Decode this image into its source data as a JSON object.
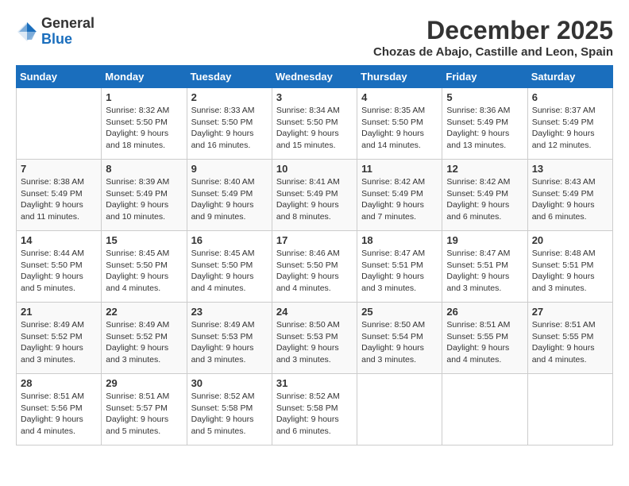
{
  "header": {
    "logo_general": "General",
    "logo_blue": "Blue",
    "month_year": "December 2025",
    "location": "Chozas de Abajo, Castille and Leon, Spain"
  },
  "weekdays": [
    "Sunday",
    "Monday",
    "Tuesday",
    "Wednesday",
    "Thursday",
    "Friday",
    "Saturday"
  ],
  "weeks": [
    [
      {
        "day": "",
        "sunrise": "",
        "sunset": "",
        "daylight": ""
      },
      {
        "day": "1",
        "sunrise": "Sunrise: 8:32 AM",
        "sunset": "Sunset: 5:50 PM",
        "daylight": "Daylight: 9 hours and 18 minutes."
      },
      {
        "day": "2",
        "sunrise": "Sunrise: 8:33 AM",
        "sunset": "Sunset: 5:50 PM",
        "daylight": "Daylight: 9 hours and 16 minutes."
      },
      {
        "day": "3",
        "sunrise": "Sunrise: 8:34 AM",
        "sunset": "Sunset: 5:50 PM",
        "daylight": "Daylight: 9 hours and 15 minutes."
      },
      {
        "day": "4",
        "sunrise": "Sunrise: 8:35 AM",
        "sunset": "Sunset: 5:50 PM",
        "daylight": "Daylight: 9 hours and 14 minutes."
      },
      {
        "day": "5",
        "sunrise": "Sunrise: 8:36 AM",
        "sunset": "Sunset: 5:49 PM",
        "daylight": "Daylight: 9 hours and 13 minutes."
      },
      {
        "day": "6",
        "sunrise": "Sunrise: 8:37 AM",
        "sunset": "Sunset: 5:49 PM",
        "daylight": "Daylight: 9 hours and 12 minutes."
      }
    ],
    [
      {
        "day": "7",
        "sunrise": "Sunrise: 8:38 AM",
        "sunset": "Sunset: 5:49 PM",
        "daylight": "Daylight: 9 hours and 11 minutes."
      },
      {
        "day": "8",
        "sunrise": "Sunrise: 8:39 AM",
        "sunset": "Sunset: 5:49 PM",
        "daylight": "Daylight: 9 hours and 10 minutes."
      },
      {
        "day": "9",
        "sunrise": "Sunrise: 8:40 AM",
        "sunset": "Sunset: 5:49 PM",
        "daylight": "Daylight: 9 hours and 9 minutes."
      },
      {
        "day": "10",
        "sunrise": "Sunrise: 8:41 AM",
        "sunset": "Sunset: 5:49 PM",
        "daylight": "Daylight: 9 hours and 8 minutes."
      },
      {
        "day": "11",
        "sunrise": "Sunrise: 8:42 AM",
        "sunset": "Sunset: 5:49 PM",
        "daylight": "Daylight: 9 hours and 7 minutes."
      },
      {
        "day": "12",
        "sunrise": "Sunrise: 8:42 AM",
        "sunset": "Sunset: 5:49 PM",
        "daylight": "Daylight: 9 hours and 6 minutes."
      },
      {
        "day": "13",
        "sunrise": "Sunrise: 8:43 AM",
        "sunset": "Sunset: 5:49 PM",
        "daylight": "Daylight: 9 hours and 6 minutes."
      }
    ],
    [
      {
        "day": "14",
        "sunrise": "Sunrise: 8:44 AM",
        "sunset": "Sunset: 5:50 PM",
        "daylight": "Daylight: 9 hours and 5 minutes."
      },
      {
        "day": "15",
        "sunrise": "Sunrise: 8:45 AM",
        "sunset": "Sunset: 5:50 PM",
        "daylight": "Daylight: 9 hours and 4 minutes."
      },
      {
        "day": "16",
        "sunrise": "Sunrise: 8:45 AM",
        "sunset": "Sunset: 5:50 PM",
        "daylight": "Daylight: 9 hours and 4 minutes."
      },
      {
        "day": "17",
        "sunrise": "Sunrise: 8:46 AM",
        "sunset": "Sunset: 5:50 PM",
        "daylight": "Daylight: 9 hours and 4 minutes."
      },
      {
        "day": "18",
        "sunrise": "Sunrise: 8:47 AM",
        "sunset": "Sunset: 5:51 PM",
        "daylight": "Daylight: 9 hours and 3 minutes."
      },
      {
        "day": "19",
        "sunrise": "Sunrise: 8:47 AM",
        "sunset": "Sunset: 5:51 PM",
        "daylight": "Daylight: 9 hours and 3 minutes."
      },
      {
        "day": "20",
        "sunrise": "Sunrise: 8:48 AM",
        "sunset": "Sunset: 5:51 PM",
        "daylight": "Daylight: 9 hours and 3 minutes."
      }
    ],
    [
      {
        "day": "21",
        "sunrise": "Sunrise: 8:49 AM",
        "sunset": "Sunset: 5:52 PM",
        "daylight": "Daylight: 9 hours and 3 minutes."
      },
      {
        "day": "22",
        "sunrise": "Sunrise: 8:49 AM",
        "sunset": "Sunset: 5:52 PM",
        "daylight": "Daylight: 9 hours and 3 minutes."
      },
      {
        "day": "23",
        "sunrise": "Sunrise: 8:49 AM",
        "sunset": "Sunset: 5:53 PM",
        "daylight": "Daylight: 9 hours and 3 minutes."
      },
      {
        "day": "24",
        "sunrise": "Sunrise: 8:50 AM",
        "sunset": "Sunset: 5:53 PM",
        "daylight": "Daylight: 9 hours and 3 minutes."
      },
      {
        "day": "25",
        "sunrise": "Sunrise: 8:50 AM",
        "sunset": "Sunset: 5:54 PM",
        "daylight": "Daylight: 9 hours and 3 minutes."
      },
      {
        "day": "26",
        "sunrise": "Sunrise: 8:51 AM",
        "sunset": "Sunset: 5:55 PM",
        "daylight": "Daylight: 9 hours and 4 minutes."
      },
      {
        "day": "27",
        "sunrise": "Sunrise: 8:51 AM",
        "sunset": "Sunset: 5:55 PM",
        "daylight": "Daylight: 9 hours and 4 minutes."
      }
    ],
    [
      {
        "day": "28",
        "sunrise": "Sunrise: 8:51 AM",
        "sunset": "Sunset: 5:56 PM",
        "daylight": "Daylight: 9 hours and 4 minutes."
      },
      {
        "day": "29",
        "sunrise": "Sunrise: 8:51 AM",
        "sunset": "Sunset: 5:57 PM",
        "daylight": "Daylight: 9 hours and 5 minutes."
      },
      {
        "day": "30",
        "sunrise": "Sunrise: 8:52 AM",
        "sunset": "Sunset: 5:58 PM",
        "daylight": "Daylight: 9 hours and 5 minutes."
      },
      {
        "day": "31",
        "sunrise": "Sunrise: 8:52 AM",
        "sunset": "Sunset: 5:58 PM",
        "daylight": "Daylight: 9 hours and 6 minutes."
      },
      {
        "day": "",
        "sunrise": "",
        "sunset": "",
        "daylight": ""
      },
      {
        "day": "",
        "sunrise": "",
        "sunset": "",
        "daylight": ""
      },
      {
        "day": "",
        "sunrise": "",
        "sunset": "",
        "daylight": ""
      }
    ]
  ]
}
